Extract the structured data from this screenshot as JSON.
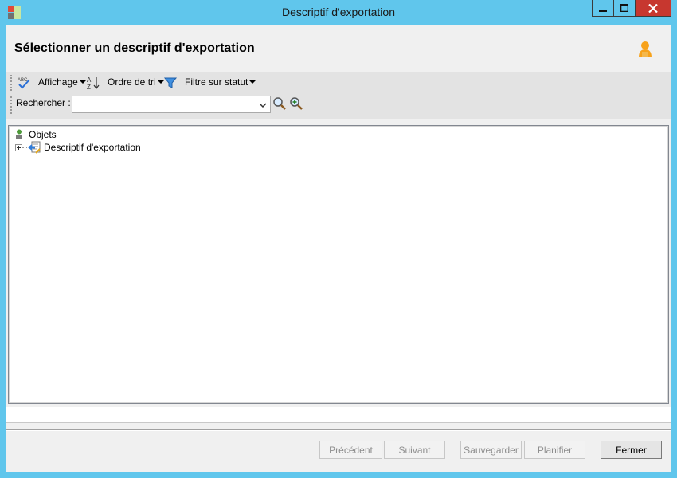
{
  "window": {
    "title": "Descriptif d'exportation"
  },
  "header": {
    "title": "Sélectionner un descriptif d'exportation"
  },
  "toolbar": {
    "display_label": "Affichage",
    "sort_label": "Ordre de tri",
    "filter_label": "Filtre sur statut",
    "search_label": "Rechercher :",
    "search_value": ""
  },
  "tree": {
    "root_label": "Objets",
    "children": [
      {
        "label": "Descriptif d'exportation"
      }
    ]
  },
  "buttons": {
    "previous": "Précédent",
    "next": "Suivant",
    "save": "Sauvegarder",
    "schedule": "Planifier",
    "close": "Fermer"
  },
  "colors": {
    "titlebar": "#60c6ec",
    "close_button": "#c7372f"
  },
  "icons": [
    "app-icon",
    "user-icon",
    "spellcheck-icon",
    "sort-az-icon",
    "filter-icon",
    "search-icon",
    "zoom-in-icon",
    "objects-icon",
    "export-descriptor-icon"
  ]
}
